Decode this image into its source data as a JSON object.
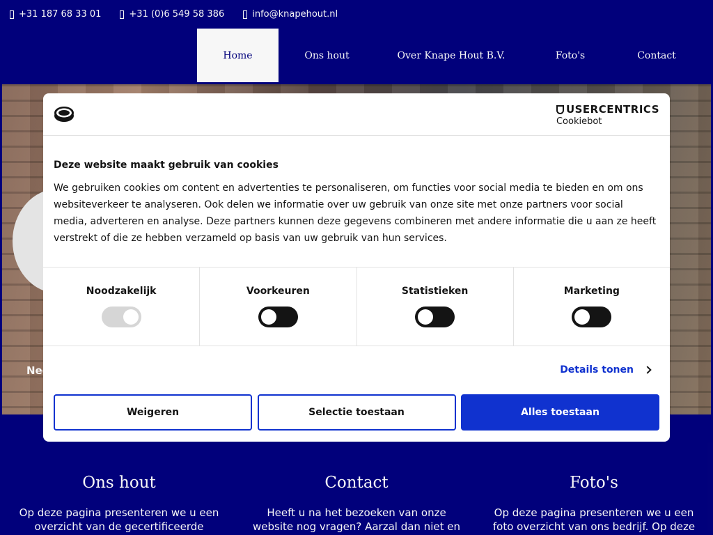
{
  "topbar": {
    "phone1": "+31 187 68 33 01",
    "phone2": "+31 (0)6 549 58 386",
    "email": "info@knapehout.nl"
  },
  "nav": {
    "items": [
      {
        "label": "Home",
        "active": true
      },
      {
        "label": "Ons hout",
        "active": false
      },
      {
        "label": "Over Knape Hout B.V.",
        "active": false
      },
      {
        "label": "Foto's",
        "active": false
      },
      {
        "label": "Contact",
        "active": false
      }
    ]
  },
  "hero": {
    "text": "Nee"
  },
  "columns": [
    {
      "title": "Ons hout",
      "text": "Op deze pagina presenteren we u een overzicht van de gecertificeerde hardhout"
    },
    {
      "title": "Contact",
      "text": "Heeft u na het bezoeken van onze website nog vragen? Aarzal dan niet en neem gerust"
    },
    {
      "title": "Foto's",
      "text": "Op deze pagina presenteren we u een foto overzicht van ons bedrijf. Op deze manier"
    }
  ],
  "cookie": {
    "brand_top": "USERCENTRICS",
    "brand_sub": "Cookiebot",
    "heading": "Deze website maakt gebruik van cookies",
    "body": "We gebruiken cookies om content en advertenties te personaliseren, om functies voor social media te bieden en om ons websiteverkeer te analyseren. Ook delen we informatie over uw gebruik van onze site met onze partners voor social media, adverteren en analyse. Deze partners kunnen deze gegevens combineren met andere informatie die u aan ze heeft verstrekt of die ze hebben verzameld op basis van uw gebruik van hun services.",
    "categories": [
      {
        "label": "Noodzakelijk",
        "enabled": true,
        "locked": true
      },
      {
        "label": "Voorkeuren",
        "enabled": false,
        "locked": false
      },
      {
        "label": "Statistieken",
        "enabled": false,
        "locked": false
      },
      {
        "label": "Marketing",
        "enabled": false,
        "locked": false
      }
    ],
    "details_label": "Details tonen",
    "buttons": {
      "deny": "Weigeren",
      "selection": "Selectie toestaan",
      "allow_all": "Alles toestaan"
    },
    "colors": {
      "accent": "#1032cf",
      "page_bg": "#02017f"
    }
  }
}
